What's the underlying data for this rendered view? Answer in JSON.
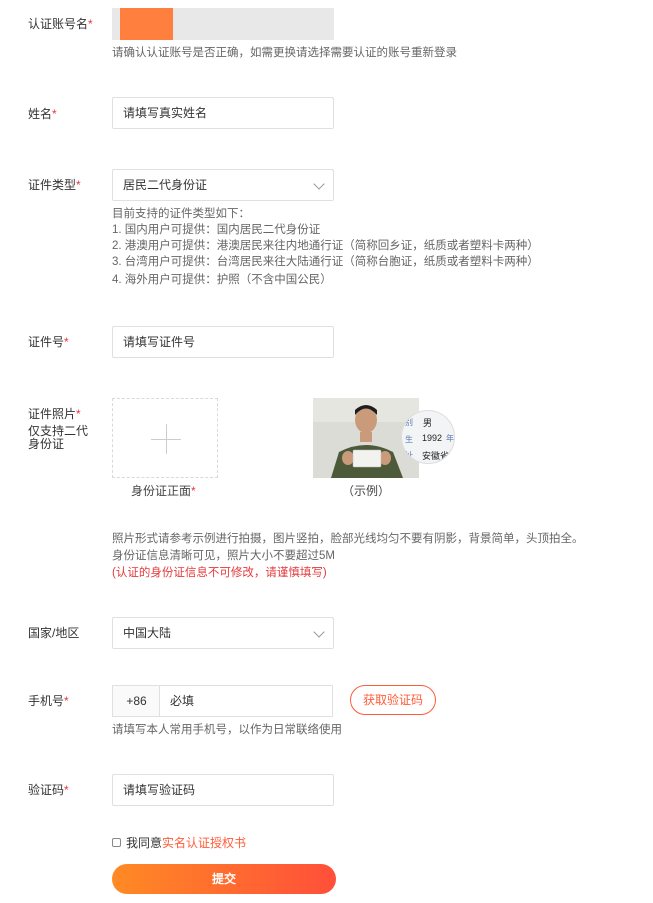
{
  "account": {
    "label": "认证账号名",
    "required_mark": "*",
    "hint": "请确认认证账号是否正确，如需更换请选择需要认证的账号重新登录"
  },
  "name": {
    "label": "姓名",
    "required_mark": "*",
    "placeholder": "请填写真实姓名"
  },
  "id_type": {
    "label": "证件类型",
    "required_mark": "*",
    "selected": "居民二代身份证",
    "notes": [
      "目前支持的证件类型如下：",
      "1. 国内用户可提供：国内居民二代身份证",
      "2. 港澳用户可提供：港澳居民来往内地通行证（简称回乡证，纸质或者塑料卡两种）",
      "3. 台湾用户可提供：台湾居民来往大陆通行证（简称台胞证，纸质或者塑料卡两种）",
      "4. 海外用户可提供：护照（不含中国公民）"
    ]
  },
  "id_number": {
    "label": "证件号",
    "required_mark": "*",
    "placeholder": "请填写证件号"
  },
  "id_photo": {
    "label": "证件照片",
    "required_mark": "*",
    "sublabel_line1": "仅支持二代",
    "sublabel_line2": "身份证",
    "upload_caption": "身份证正面",
    "upload_required_mark": "*",
    "example_caption": "（示例）",
    "example_card_text": {
      "gender": "男",
      "year": "1992",
      "year_suffix": "年",
      "side_1": "别",
      "side_2": "生",
      "side_3": "址",
      "addr": "安徽省"
    },
    "hint_line1": "照片形式请参考示例进行拍摄，图片竖拍，脸部光线均匀不要有阴影，背景简单，头顶拍全。",
    "hint_line2": "身份证信息清晰可见，照片大小不要超过5M",
    "warning": "(认证的身份证信息不可修改，请谨慎填写)"
  },
  "country": {
    "label": "国家/地区",
    "selected": "中国大陆"
  },
  "phone": {
    "label": "手机号",
    "required_mark": "*",
    "prefix": "+86",
    "placeholder": "必填",
    "get_code_label": "获取验证码",
    "hint": "请填写本人常用手机号，以作为日常联络使用"
  },
  "verify_code": {
    "label": "验证码",
    "required_mark": "*",
    "placeholder": "请填写验证码"
  },
  "agreement": {
    "prefix": "我同意",
    "link": "实名认证授权书"
  },
  "submit_label": "提交",
  "colors": {
    "accent": "#ff5c38",
    "required": "#e4393c",
    "avatar_orange": "#ff7f3f",
    "account_bar": "#e8e8e8"
  }
}
